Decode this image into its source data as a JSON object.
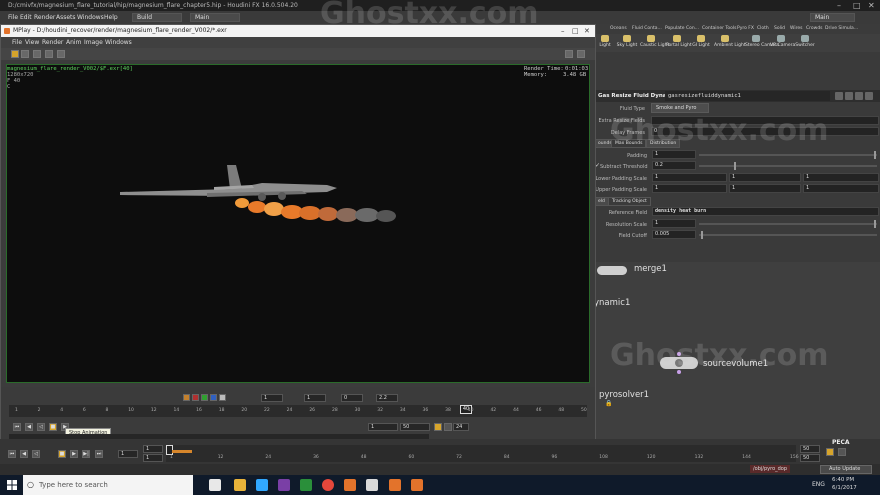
{
  "houdini": {
    "title": "D:/cmivfx/magnesium_flare_tutorial/hip/magnesium_flare_chapter5.hip - Houdini FX 16.0.504.20",
    "menu": [
      "File",
      "Edit",
      "Render",
      "Assets",
      "Windows",
      "Help"
    ],
    "desktop_left": "Build",
    "desktop_right": "Main",
    "main_label": "Main"
  },
  "shelf": {
    "tabs": [
      "Oceans",
      "Fluid Conta...",
      "Populate Con...",
      "Container Tools",
      "Pyro FX",
      "Cloth",
      "Solid",
      "Wires",
      "Crowds",
      "Drive Simula..."
    ],
    "tools": [
      "Light",
      "Sky Light",
      "Caustic Light",
      "Portal Light",
      "GI Light",
      "Ambient Light",
      "Stereo Camera",
      "VR Camera",
      "Switcher"
    ]
  },
  "params": {
    "node_type": "Gas Resize Fluid Dynamic",
    "node_name": "gasresizefluiddynamic1",
    "fluid_type_label": "Fluid Type",
    "fluid_type_value": "Smoke and Pyro",
    "extra_fields_label": "Extra Resize Fields",
    "delay_frames_label": "Delay Frames",
    "delay_frames_value": "0",
    "tabs_a": [
      "ounds",
      "Max Bounds",
      "Distribution"
    ],
    "padding_label": "Padding",
    "padding_value": "1",
    "subtract_label": "Subtract Threshold",
    "subtract_value": "0.2",
    "lower_padding_label": "Lower Padding Scale",
    "lower_padding": [
      "1",
      "1",
      "1"
    ],
    "upper_padding_label": "Upper Padding Scale",
    "upper_padding": [
      "1",
      "1",
      "1"
    ],
    "tabs_b": [
      "eld",
      "Tracking Object"
    ],
    "reference_field_label": "Reference Field",
    "reference_field_value": "density heat burn",
    "resolution_scale_label": "Resolution Scale",
    "resolution_scale_value": "1",
    "field_cutoff_label": "Field Cutoff",
    "field_cutoff_value": "0.005"
  },
  "network": {
    "merge_label": "merge1",
    "dynamic_label": "ynamic1",
    "source_label": "sourcevolume1",
    "pyro_label": "pyrosolver1",
    "path": "/obj/pyro_dop",
    "auto_update": "Auto Update"
  },
  "mplay": {
    "title": "MPlay - D:/houdini_recover/render/magnesium_flare_render_V002/*.exr",
    "menu": [
      "File",
      "View",
      "Render",
      "Anim",
      "Image",
      "Windows"
    ],
    "overlay_line1": "magnesium_flare_render_V002/$F.exr[40]",
    "overlay_line2": "1280x720",
    "overlay_line3": "F 40",
    "overlay_line4": "C",
    "render_time_label": "Render Time:",
    "render_time_value": "0:01:03",
    "memory_label": "Memory:",
    "memory_value": "3.48 GB",
    "ctl_values": [
      "1",
      "1",
      "0",
      "2.2"
    ],
    "timeline_ticks": [
      "1",
      "2",
      "4",
      "6",
      "8",
      "10",
      "12",
      "14",
      "16",
      "18",
      "20",
      "22",
      "24",
      "26",
      "28",
      "30",
      "32",
      "34",
      "36",
      "38",
      "40",
      "42",
      "44",
      "46",
      "48",
      "50"
    ],
    "current_frame": "40",
    "range_start": "1",
    "range_end": "50",
    "fps": "24",
    "tooltip": "Stop Animation"
  },
  "playbar": {
    "frame": "1",
    "start": "1",
    "end_a": "1",
    "ticks": [
      "1",
      "12",
      "24",
      "36",
      "48",
      "60",
      "72",
      "84",
      "96",
      "108",
      "120",
      "132",
      "144",
      "156"
    ],
    "range_end_a": "50",
    "range_end_b": "50"
  },
  "taskbar": {
    "search_placeholder": "Type here to search",
    "lang": "ENG",
    "time": "6:40 PM",
    "date": "6/1/2017"
  },
  "watermark": "Ghostxx.com",
  "badge": "PECA"
}
